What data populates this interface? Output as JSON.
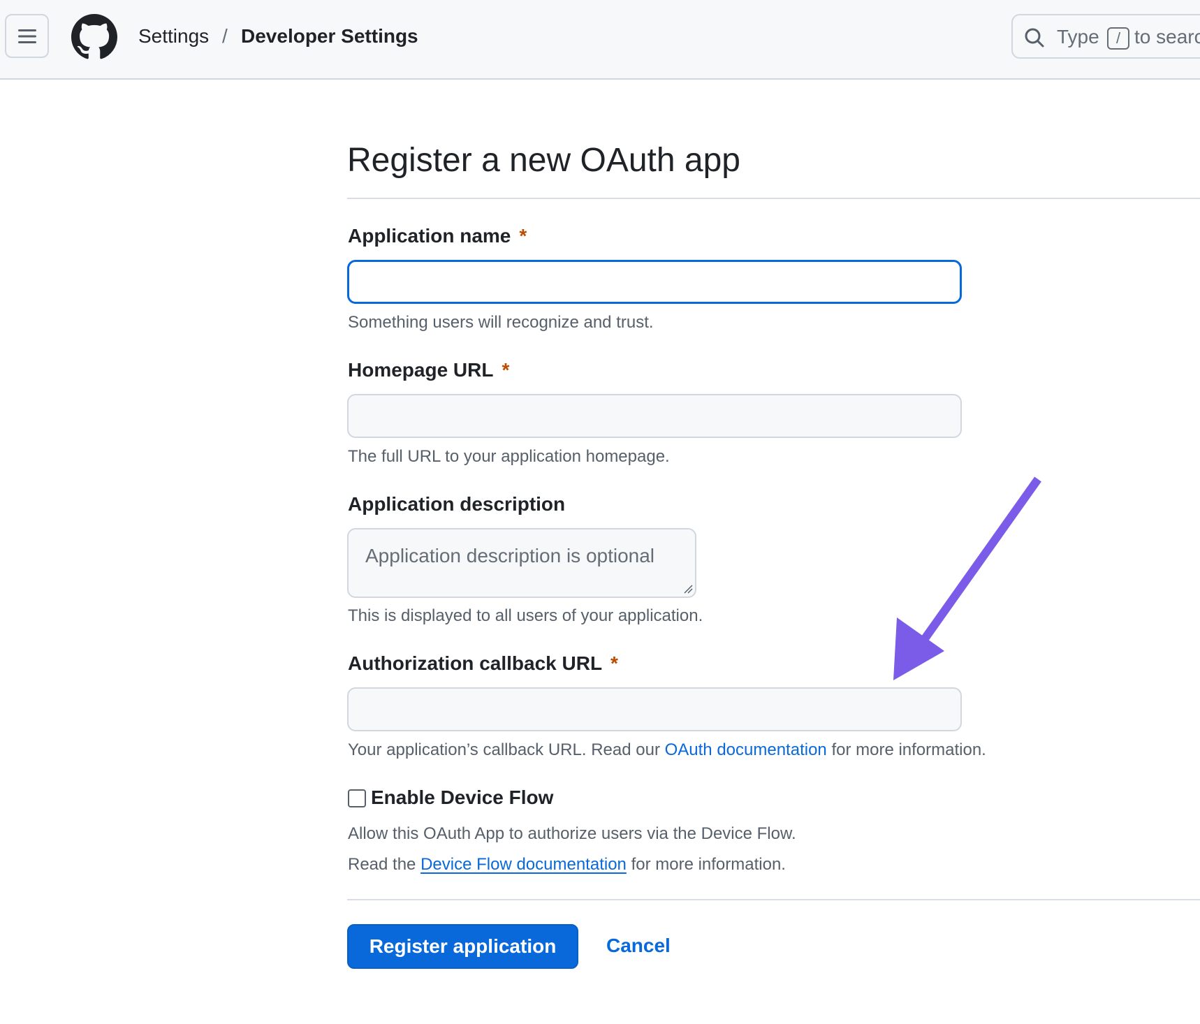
{
  "header": {
    "menu_icon": "hamburger-menu-icon",
    "logo_icon": "github-mark-icon",
    "breadcrumb": {
      "parent": "Settings",
      "separator": "/",
      "current": "Developer Settings"
    },
    "search": {
      "icon": "search-icon",
      "prefix": "Type",
      "shortcut_key": "/",
      "suffix": "to searc"
    }
  },
  "form": {
    "title": "Register a new OAuth app",
    "required_marker": "*",
    "fields": {
      "app_name": {
        "label": "Application name",
        "value": "",
        "hint": "Something users will recognize and trust."
      },
      "homepage_url": {
        "label": "Homepage URL",
        "value": "",
        "hint": "The full URL to your application homepage."
      },
      "description": {
        "label": "Application description",
        "placeholder": "Application description is optional",
        "hint": "This is displayed to all users of your application."
      },
      "callback_url": {
        "label": "Authorization callback URL",
        "value": "",
        "hint_before": "Your application’s callback URL. Read our",
        "hint_link": "OAuth documentation",
        "hint_after": "for more information."
      }
    },
    "device_flow": {
      "label": "Enable Device Flow",
      "checked": false,
      "desc_line1": "Allow this OAuth App to authorize users via the Device Flow.",
      "desc_line2_before": "Read the",
      "desc_line2_link": "Device Flow documentation",
      "desc_line2_after": "for more information."
    },
    "actions": {
      "submit_label": "Register application",
      "cancel_label": "Cancel"
    }
  },
  "annotation": {
    "icon": "arrow-pointer-icon",
    "color": "#7b5ce8"
  },
  "colors": {
    "accent": "#0969da",
    "required": "#bc4c00",
    "header_bg": "#f6f8fa"
  }
}
